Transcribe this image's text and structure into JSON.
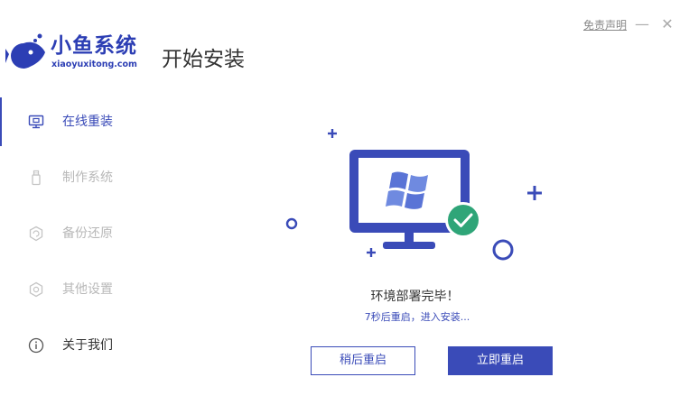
{
  "brand": {
    "name": "小鱼系统",
    "url": "xiaoyuxitong.com"
  },
  "header": {
    "title": "开始安装",
    "disclaimer": "免责声明",
    "minimize_symbol": "—",
    "close_symbol": "✕"
  },
  "sidebar": {
    "items": [
      {
        "label": "在线重装",
        "icon": "monitor-icon",
        "state": "active"
      },
      {
        "label": "制作系统",
        "icon": "usb-icon",
        "state": "disabled"
      },
      {
        "label": "备份还原",
        "icon": "backup-icon",
        "state": "disabled"
      },
      {
        "label": "其他设置",
        "icon": "settings-icon",
        "state": "disabled"
      },
      {
        "label": "关于我们",
        "icon": "info-icon",
        "state": "normal"
      }
    ]
  },
  "status": {
    "title": "环境部署完毕！",
    "subtitle": "7秒后重启，进入安装..."
  },
  "buttons": {
    "later": "稍后重启",
    "now": "立即重启"
  },
  "colors": {
    "accent": "#3a4bb8",
    "brand": "#2c3eb4",
    "success": "#2fa578",
    "disabled_text": "#b8b8b8"
  }
}
